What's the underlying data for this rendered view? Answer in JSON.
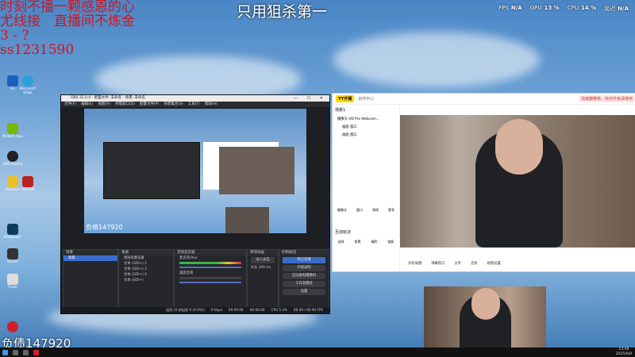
{
  "overlay": {
    "lines": [
      "时刻不播一颗感恩的心",
      "尤线接　直播间不炼金",
      "3 - ?",
      "ss1231590"
    ],
    "top_title": "只用狙杀第一",
    "follower_text": "负债147920"
  },
  "perf": {
    "fps_label": "FPS",
    "fps_value": "N/A",
    "gpu_label": "GPU",
    "gpu_value": "13 %",
    "cpu_label": "CPU",
    "cpu_value": "14 %",
    "latency_label": "延迟",
    "latency_value": "N/A"
  },
  "desktop_icons": [
    "EA",
    "Microsoft Edge",
    "NVIDIA App",
    "OBS Studio",
    "Dolphin",
    "Ubisoft",
    "Wallpaper",
    "Steam",
    "Trash"
  ],
  "obs": {
    "title": "OBS 32.0.4 - 配置文件: 未命名 - 场景: 未命名",
    "menu": [
      "文件(F)",
      "编辑(E)",
      "视图(V)",
      "停靠窗口(D)",
      "配置文件(P)",
      "场景集合(S)",
      "工具(T)",
      "帮助(H)"
    ],
    "preview_overlay": "负债147920",
    "scenes_header": "场景",
    "scenes": [
      "场景"
    ],
    "sources_header": "来源",
    "sources": [
      "视频采集设备",
      "文本 (GDI+) 2",
      "文本 (GDI+) 3",
      "文本 (GDI+) 4",
      "文本 (GDI+)"
    ],
    "mixer_header": "音频混音器",
    "mixer": [
      "麦克风/Aux",
      "桌面音频"
    ],
    "transitions_header": "转场动画",
    "transition_value": "淡入淡出",
    "duration_label": "时长",
    "duration_value": "300 ms",
    "controls_header": "控制按钮",
    "controls": [
      "停止直播",
      "开始录制",
      "启动虚拟摄像机",
      "工作室模式",
      "设置"
    ],
    "status": [
      "延迟 (0 帧出现 0 (0.0%))",
      "0 kbps",
      "00:00:04",
      "00:00:00",
      "CPU 5.3%",
      "60.00 / 60.00 FPS"
    ]
  },
  "yy": {
    "logo": "YY开播",
    "tab": "创作中心",
    "scene_label": "场景1",
    "sources": [
      "摄像头 HD Pro Webcam...",
      "画面 窗口",
      "画面 窗口"
    ],
    "tools": [
      "摄像头",
      "窗口",
      "游戏",
      "更多"
    ],
    "interact_header": "互动玩法",
    "interact": [
      "连线",
      "投票",
      "福利",
      "抽奖"
    ],
    "bottom_bar": [
      "开始录播",
      "弹幕窗口",
      "分享",
      "音效",
      "视频设置"
    ],
    "notice": "加速器推荐，快点升级请使用"
  },
  "taskbar": {
    "time": "13:48",
    "date": "2025/6/8"
  }
}
